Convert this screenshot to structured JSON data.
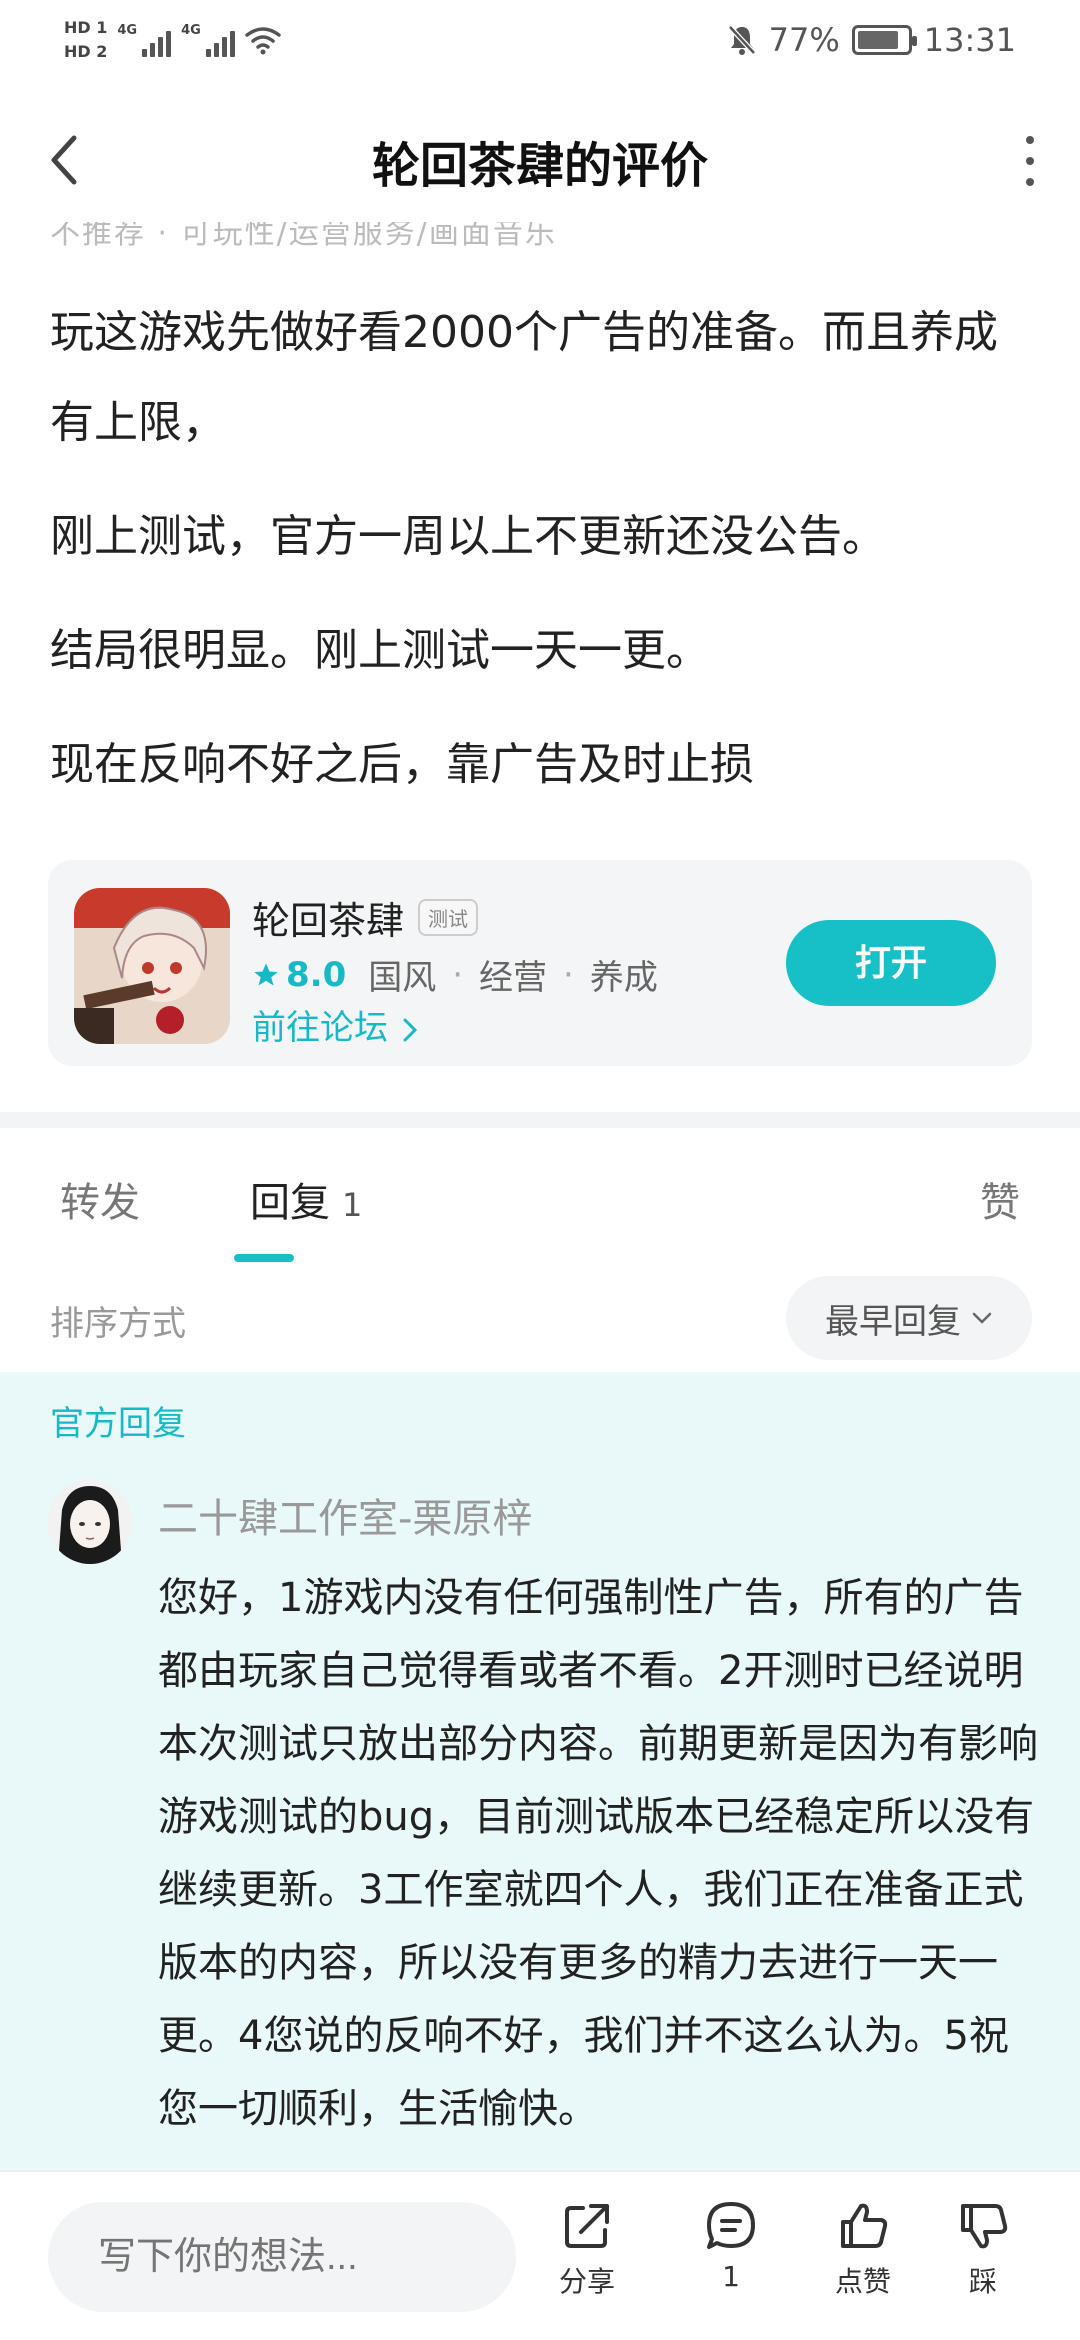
{
  "status_bar": {
    "hd1": "HD 1",
    "hd2": "HD 2",
    "net1": "4G",
    "net2": "4G",
    "battery": "77%",
    "time": "13:31"
  },
  "header": {
    "title": "轮回茶肆的评价",
    "clipped_line": "不推荐 · 可玩性/运营服务/画面音乐"
  },
  "review": {
    "paragraphs": [
      "玩这游戏先做好看2000个广告的准备。而且养成有上限，",
      "刚上测试，官方一周以上不更新还没公告。",
      "结局很明显。刚上测试一天一更。",
      "现在反响不好之后，靠广告及时止损"
    ]
  },
  "game_card": {
    "name": "轮回茶肆",
    "tag": "测试",
    "score": "8.0",
    "genres": [
      "国风",
      "经营",
      "养成"
    ],
    "forum_link": "前往论坛",
    "open_button": "打开"
  },
  "tabs": {
    "forward": "转发",
    "reply": "回复",
    "reply_count": "1",
    "like": "赞"
  },
  "sort": {
    "label": "排序方式",
    "value": "最早回复"
  },
  "official_reply": {
    "label": "官方回复",
    "author": "二十肆工作室-栗原梓",
    "text": "您好，1游戏内没有任何强制性广告，所有的广告都由玩家自己觉得看或者不看。2开测时已经说明本次测试只放出部分内容。前期更新是因为有影响游戏测试的bug，目前测试版本已经稳定所以没有继续更新。3工作室就四个人，我们正在准备正式版本的内容，所以没有更多的精力去进行一天一更。4您说的反响不好，我们并不这么认为。5祝您一切顺利，生活愉快。"
  },
  "bottom_bar": {
    "input_placeholder": "写下你的想法...",
    "share": "分享",
    "comment_count": "1",
    "like": "点赞",
    "dislike": "踩"
  },
  "colors": {
    "accent": "#17bfc6",
    "official_bg": "#e9f8f8"
  },
  "icons": [
    "back-arrow-icon",
    "more-vertical-icon",
    "star-icon",
    "chevron-right-icon",
    "chevron-down-icon",
    "share-icon",
    "comment-icon",
    "thumbs-up-icon",
    "thumbs-down-icon",
    "mute-bell-icon",
    "wifi-icon",
    "battery-icon"
  ]
}
